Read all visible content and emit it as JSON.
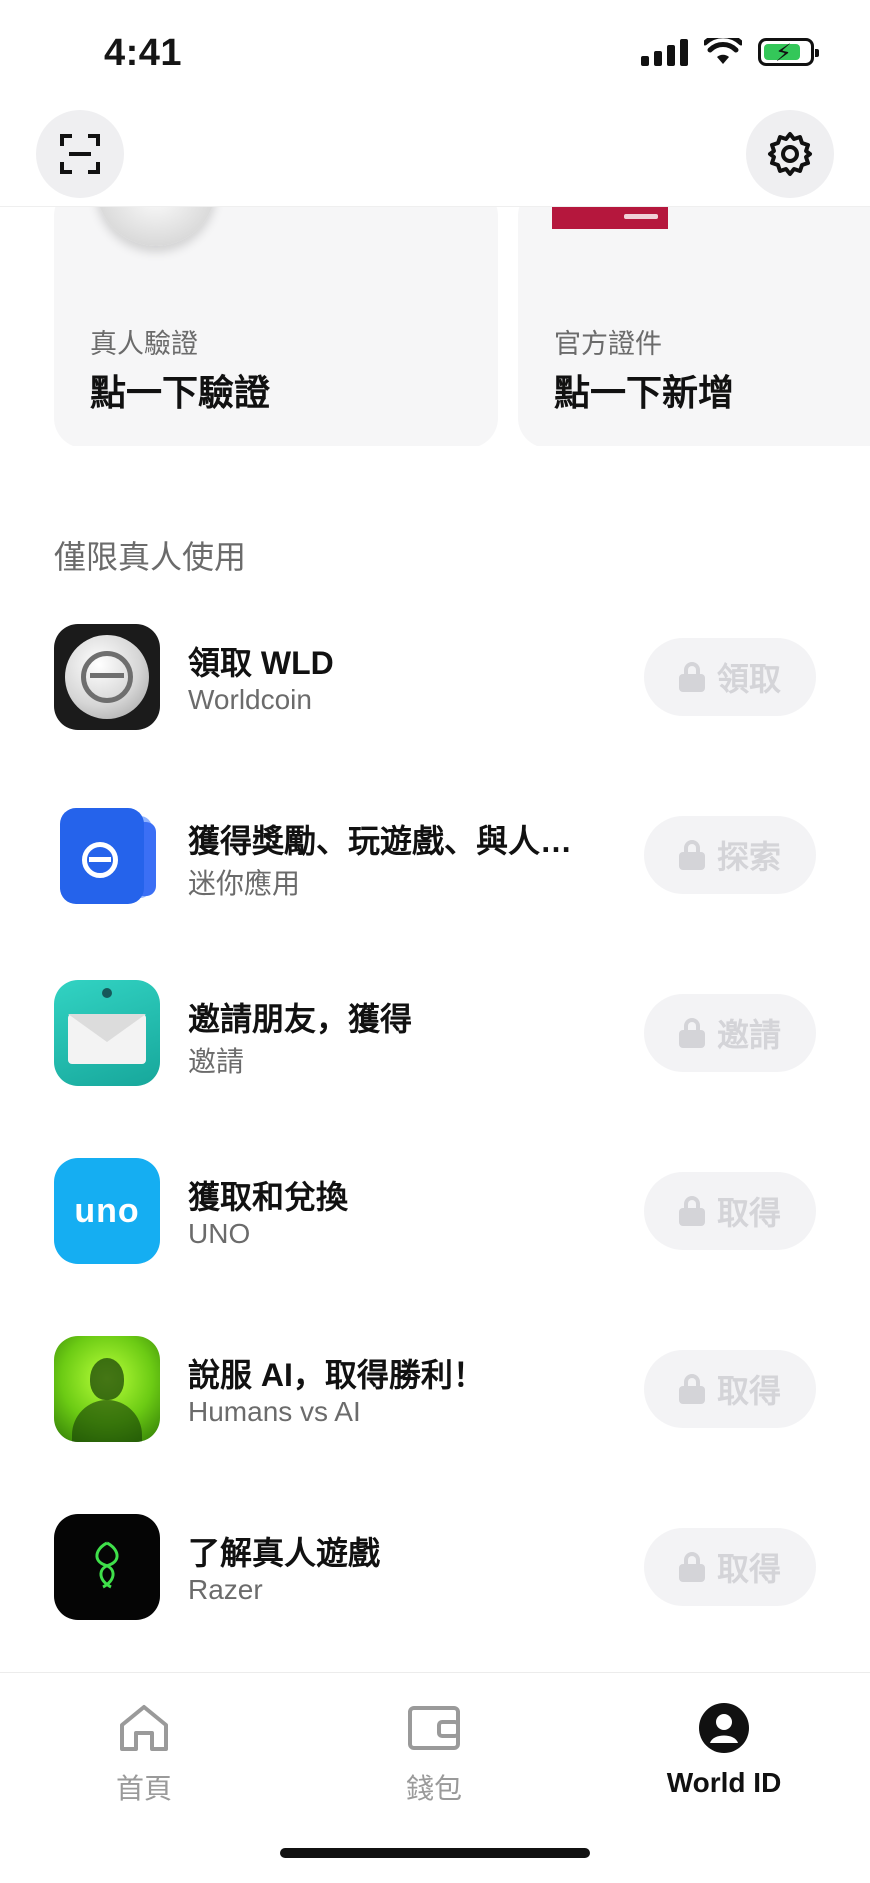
{
  "status_bar": {
    "time": "4:41"
  },
  "cards": [
    {
      "subtitle": "真人驗證",
      "title": "點一下驗證"
    },
    {
      "subtitle": "官方證件",
      "title": "點一下新增"
    }
  ],
  "section": {
    "title": "僅限真人使用"
  },
  "apps": [
    {
      "title": "領取 WLD",
      "subtitle": "Worldcoin",
      "button": "領取"
    },
    {
      "title": "獲得獎勵、玩遊戲、與人…",
      "subtitle": "迷你應用",
      "button": "探索"
    },
    {
      "title": "邀請朋友，獲得",
      "subtitle": "邀請",
      "button": "邀請"
    },
    {
      "title": "獲取和兌換",
      "subtitle": "UNO",
      "button": "取得",
      "icon_text": "uno"
    },
    {
      "title": "說服 AI，取得勝利！",
      "subtitle": "Humans vs AI",
      "button": "取得"
    },
    {
      "title": "了解真人遊戲",
      "subtitle": "Razer",
      "button": "取得"
    }
  ],
  "tabbar": {
    "home": "首頁",
    "wallet": "錢包",
    "world_id": "World ID",
    "active": "world_id"
  },
  "colors": {
    "accent": "#111111",
    "battery": "#34c759",
    "disabled": "#d4d4d8"
  }
}
